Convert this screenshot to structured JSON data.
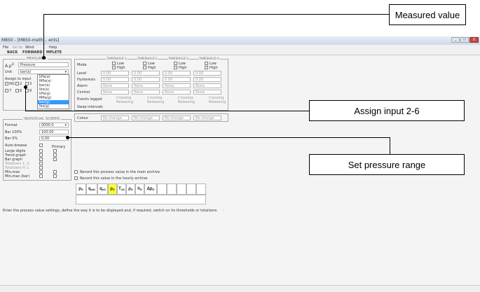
{
  "callouts": {
    "measured": "Measured value",
    "assign": "Assign input 2-6",
    "pressure": "Set pressure range"
  },
  "window": {
    "title": "M850 - [M850-meth... ents]",
    "controls": [
      "_",
      "□",
      "X"
    ]
  },
  "menu": {
    "file": "File",
    "goto": "Go to:",
    "window": "Wind",
    "help": "Help"
  },
  "toolbar": {
    "back": "BACK",
    "forward": "FORWARD",
    "complete": "MPLETE"
  },
  "measured_panel": {
    "group": "MEASURED",
    "tag": "A.p",
    "tag_sup": "D",
    "name": "Pressure",
    "unit_label": "Unit",
    "unit_value": "bar(a)",
    "assign_label": "Assign to input",
    "inputs": [
      "IN1",
      "2",
      "3",
      "7",
      "8",
      "9"
    ],
    "unit_options": [
      "bar(a)",
      "kPa(a)",
      "MPa(a)",
      "bar(a)",
      "lbs(a)",
      "kPa(g)",
      "MPa(g)",
      "bar(g)",
      "lbs(g)"
    ]
  },
  "thresholds": {
    "heads": [
      "THRESHOLD 1",
      "THRESHOLD 2",
      "THRESHOLD 3",
      "THRESHOLD 4"
    ],
    "low": "Low",
    "high": "High",
    "rows": [
      "Mode",
      "Level",
      "Hysteresis",
      "Alarm",
      "Control",
      "Events logged",
      "Swap intervals"
    ],
    "level": "0.00",
    "hysteresis": "0.00",
    "none": "None",
    "crossing": "Crossing",
    "releasing": "Releasing",
    "colour_label": "Colour",
    "no_change": "No change"
  },
  "individual": {
    "group": "INDIVIDUAL SCREEN",
    "format_label": "Format",
    "format_value": "0000.0",
    "bar100_label": "Bar 100%",
    "bar100_value": "100.00",
    "bar0_label": "Bar 0%",
    "bar0_value": "0.00",
    "primary": "Primary",
    "options": [
      "Auto-browse",
      "Large digits",
      "Trend graph",
      "Bar graph",
      "Totalizers 1..3",
      "Totalizers H, L",
      "Min,max",
      "Min,max (bar)"
    ]
  },
  "archive": {
    "main": "Record this process value in the main archive.",
    "hourly": "Record this value in the hourly archive"
  },
  "symbols": [
    {
      "base": "p",
      "sup": "D"
    },
    {
      "base": "q",
      "sub": "m",
      "sup": "D"
    },
    {
      "base": "q",
      "sub": "v",
      "sup": "D"
    },
    {
      "base": "p",
      "sup": "D"
    },
    {
      "base": "T",
      "sub": "c",
      "sup": "D"
    },
    {
      "base": "ρ",
      "sup": "D"
    },
    {
      "base": "h",
      "sup": "D"
    },
    {
      "base": "Δp",
      "sup": "D"
    }
  ],
  "help_text": "Enter the process value settings, define the way it is to be displayed and, if required, switch on its thresholds or totalizers."
}
